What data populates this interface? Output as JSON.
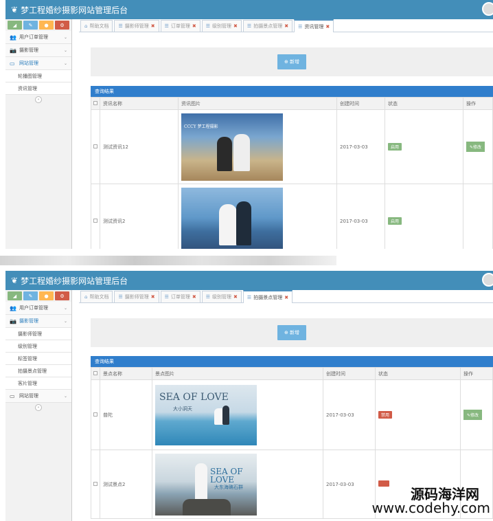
{
  "app_title": "梦工程婚纱摄影网站管理后台",
  "shortcut_colors": [
    "#87b87f",
    "#6fb3e0",
    "#ffb752",
    "#d15b47"
  ],
  "panel1": {
    "sidebar": {
      "menus": [
        {
          "label": "用户订单管理",
          "icon": "users-icon",
          "active": false
        },
        {
          "label": "摄影管理",
          "icon": "camera-icon",
          "active": false
        },
        {
          "label": "网站管理",
          "icon": "desktop-icon",
          "active": true
        }
      ],
      "submenu": [
        "轮播图管理",
        "资讯管理"
      ]
    },
    "tabs": [
      {
        "label": "帮助文档",
        "closable": false,
        "active": false
      },
      {
        "label": "摄影师管理",
        "closable": true,
        "active": false
      },
      {
        "label": "订单管理",
        "closable": true,
        "active": false
      },
      {
        "label": "级别管理",
        "closable": true,
        "active": false
      },
      {
        "label": "拍摄景点管理",
        "closable": true,
        "active": false
      },
      {
        "label": "资讯管理",
        "closable": true,
        "active": true
      }
    ],
    "add_button": "新增",
    "results_title": "查询结果",
    "columns": [
      "资讯名称",
      "资讯图片",
      "创建时间",
      "状态",
      "操作"
    ],
    "rows": [
      {
        "name": "测试资讯12",
        "photo_caption": "CCCY 梦工程摄影",
        "date": "2017-03-03",
        "status": "启用",
        "status_color": "#87b87f",
        "action": "修改"
      },
      {
        "name": "测试资讯2",
        "photo_caption": "",
        "date": "2017-03-03",
        "status": "启用",
        "status_color": "#87b87f",
        "action": ""
      }
    ]
  },
  "panel2": {
    "sidebar": {
      "menus_top": [
        {
          "label": "用户订单管理",
          "icon": "users-icon",
          "active": false
        },
        {
          "label": "摄影管理",
          "icon": "camera-icon",
          "active": true
        }
      ],
      "submenu": [
        "摄影师管理",
        "级别管理",
        "标签管理",
        "拍摄景点管理",
        "客片管理"
      ],
      "menus_bottom": [
        {
          "label": "网站管理",
          "icon": "desktop-icon",
          "active": false
        }
      ]
    },
    "tabs": [
      {
        "label": "帮助文档",
        "closable": false,
        "active": false
      },
      {
        "label": "摄影师管理",
        "closable": true,
        "active": false
      },
      {
        "label": "订单管理",
        "closable": true,
        "active": false
      },
      {
        "label": "级别管理",
        "closable": true,
        "active": false
      },
      {
        "label": "拍摄景点管理",
        "closable": true,
        "active": true
      }
    ],
    "add_button": "新增",
    "results_title": "查询结果",
    "columns": [
      "景点名称",
      "景点图片",
      "创建时间",
      "状态",
      "操作"
    ],
    "rows": [
      {
        "name": "普陀",
        "photo_title": "SEA OF LOVE",
        "photo_sub": "大小洞天",
        "date": "2017-03-03",
        "status": "禁用",
        "status_color": "#d15b47",
        "action": "修改"
      },
      {
        "name": "测试景点2",
        "photo_title": "SEA OF LOVE",
        "photo_sub": "大东海礁石群",
        "date": "2017-03-03",
        "status": "",
        "status_color": "#d15b47",
        "action": ""
      }
    ]
  },
  "watermark": {
    "line1": "源码海洋网",
    "line2": "www.codehy.com"
  }
}
